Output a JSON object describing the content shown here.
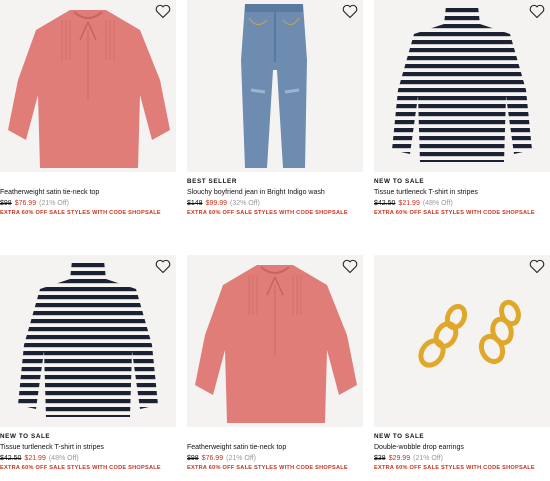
{
  "products": [
    {
      "badge": "",
      "name": "Featherweight satin tie-neck top",
      "original_price": "$98",
      "sale_price": "$76.99",
      "discount": "(21% Off)",
      "promo": "EXTRA 60% OFF SALE STYLES WITH CODE SHOPSALE",
      "image": "pink-blouse"
    },
    {
      "badge": "BEST SELLER",
      "name": "Slouchy boyfriend jean in Bright Indigo wash",
      "original_price": "$148",
      "sale_price": "$99.99",
      "discount": "(32% Off)",
      "promo": "EXTRA 60% OFF SALE STYLES WITH CODE SHOPSALE",
      "image": "jeans"
    },
    {
      "badge": "NEW TO SALE",
      "name": "Tissue turtleneck T-shirt in stripes",
      "original_price": "$42.50",
      "sale_price": "$21.99",
      "discount": "(48% Off)",
      "promo": "EXTRA 60% OFF SALE STYLES WITH CODE SHOPSALE",
      "image": "striped-turtleneck"
    },
    {
      "badge": "NEW TO SALE",
      "name": "Tissue turtleneck T-shirt in stripes",
      "original_price": "$42.50",
      "sale_price": "$21.99",
      "discount": "(48% Off)",
      "promo": "EXTRA 60% OFF SALE STYLES WITH CODE SHOPSALE",
      "image": "striped-turtleneck"
    },
    {
      "badge": "",
      "name": "Featherweight satin tie-neck top",
      "original_price": "$98",
      "sale_price": "$76.99",
      "discount": "(21% Off)",
      "promo": "EXTRA 60% OFF SALE STYLES WITH CODE SHOPSALE",
      "image": "pink-blouse"
    },
    {
      "badge": "NEW TO SALE",
      "name": "Double-wobble drop earrings",
      "original_price": "$38",
      "sale_price": "$29.99",
      "discount": "(21% Off)",
      "promo": "EXTRA 60% OFF SALE STYLES WITH CODE SHOPSALE",
      "image": "gold-earrings"
    }
  ],
  "colors": {
    "sale": "#c8321e",
    "image_bg": "#f4f3f1",
    "blouse": "#e07d78",
    "denim": "#6d8cb0",
    "stripe_dark": "#1c2233",
    "gold": "#e0a82a"
  }
}
